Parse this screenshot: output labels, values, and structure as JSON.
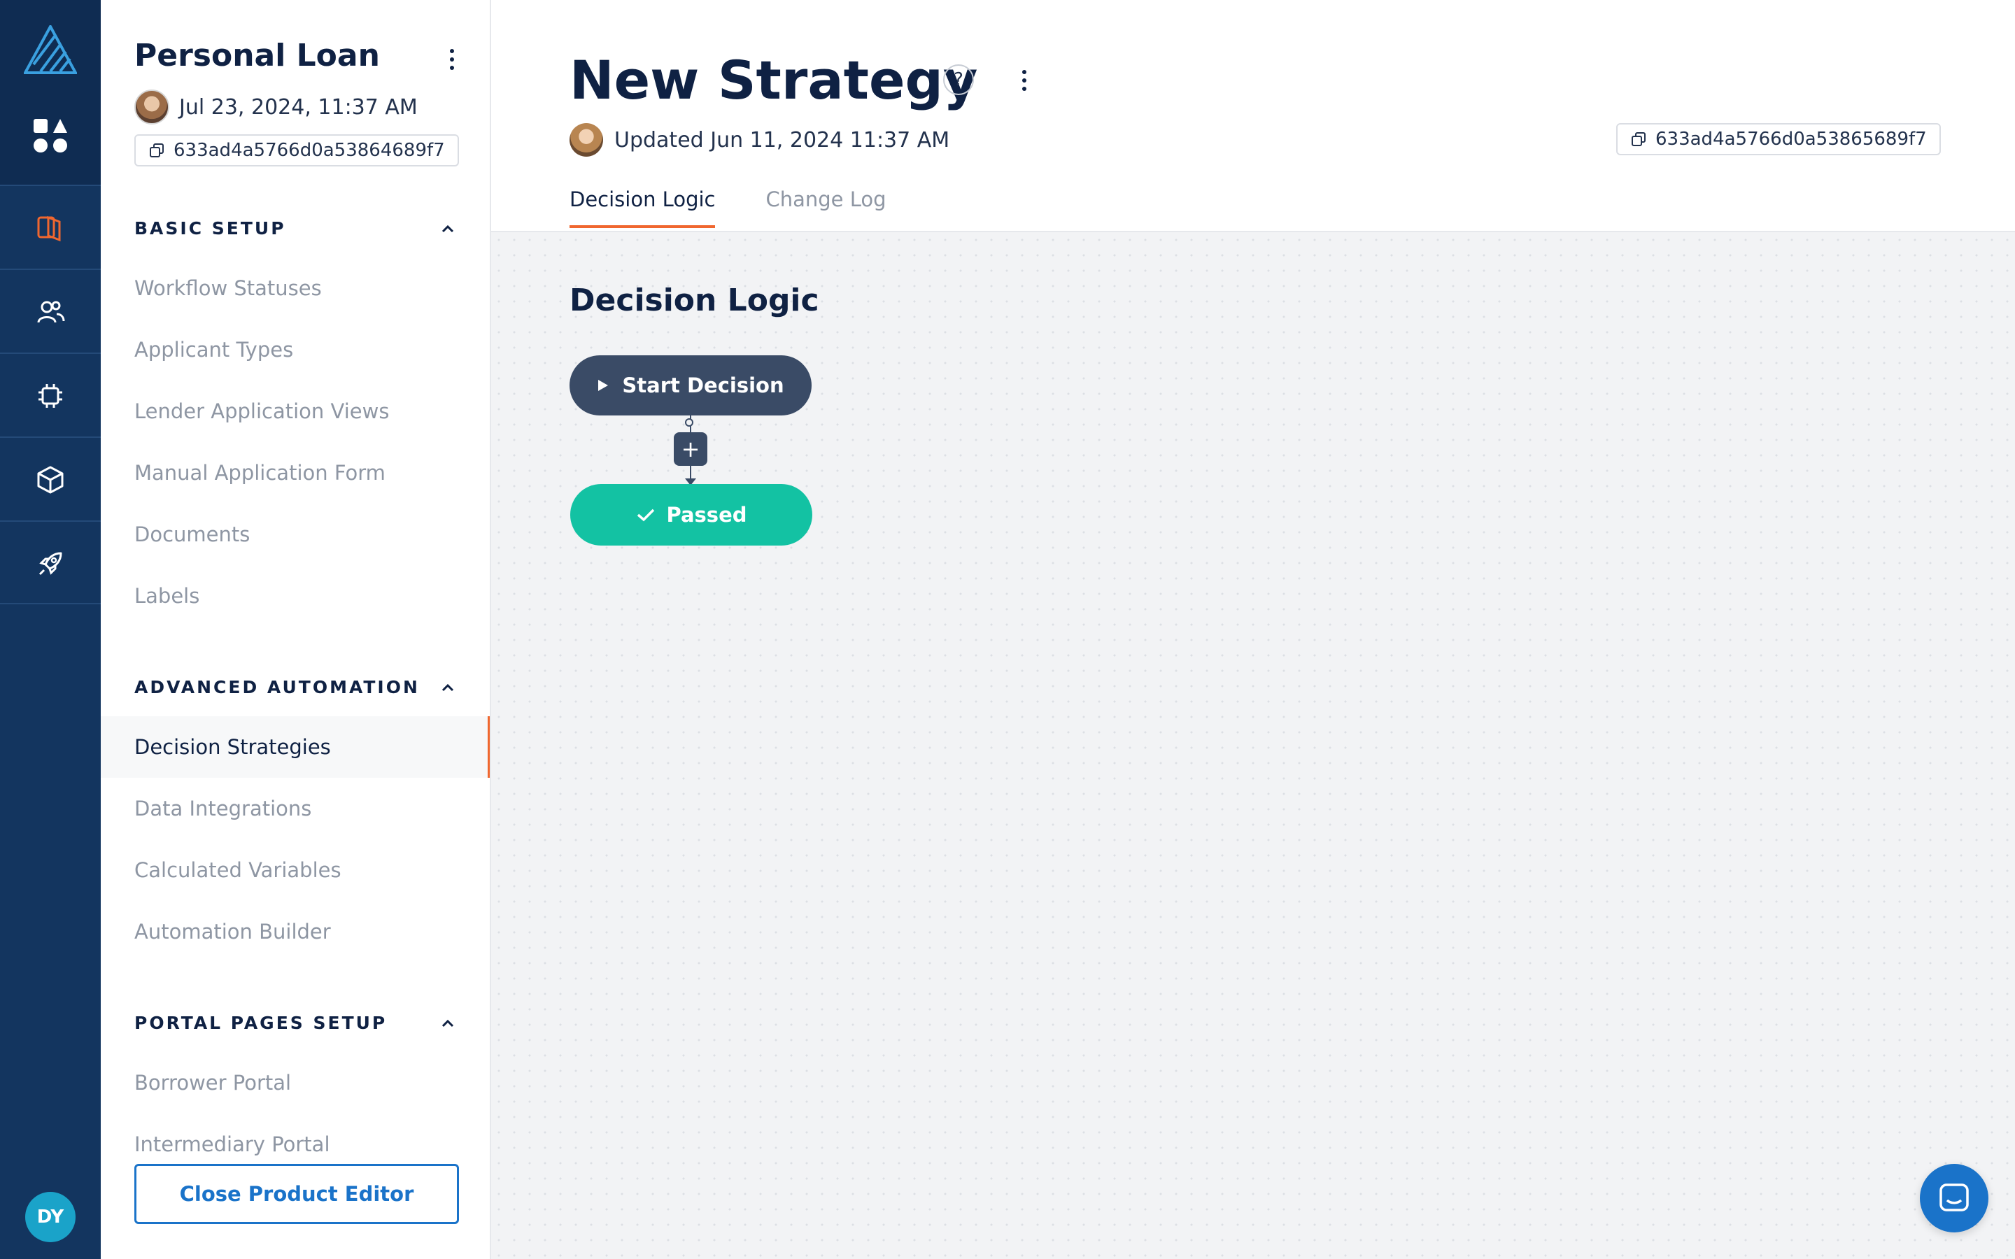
{
  "rail": {
    "icons": [
      "company-logo-icon",
      "apps-icon",
      "loan-product-icon",
      "users-icon",
      "chip-icon",
      "cube-icon",
      "rocket-icon"
    ],
    "user_initials": "DY"
  },
  "sidebar": {
    "product_title": "Personal Loan",
    "date": "Jul 23, 2024, 11:37 AM",
    "id": "633ad4a5766d0a53864689f7",
    "sections": [
      {
        "title": "BASIC SETUP",
        "items": [
          "Workflow Statuses",
          "Applicant Types",
          "Lender Application Views",
          "Manual Application Form",
          "Documents",
          "Labels"
        ]
      },
      {
        "title": "ADVANCED AUTOMATION",
        "items": [
          "Decision Strategies",
          "Data Integrations",
          "Calculated Variables",
          "Automation Builder"
        ]
      },
      {
        "title": "PORTAL PAGES SETUP",
        "items": [
          "Borrower Portal",
          "Intermediary Portal"
        ]
      }
    ],
    "active_item": "Decision Strategies",
    "close_button": "Close Product Editor"
  },
  "header": {
    "title": "New Strategy",
    "help": "?",
    "updated": "Updated Jun 11, 2024 11:37 AM",
    "id": "633ad4a5766d0a53865689f7",
    "tabs": [
      "Decision Logic",
      "Change Log"
    ],
    "active_tab": "Decision Logic"
  },
  "canvas": {
    "title": "Decision Logic",
    "start_node": "Start Decision",
    "add_symbol": "+",
    "result_node": "Passed"
  },
  "colors": {
    "rail": "#13355f",
    "accent": "#f0672f",
    "link": "#1a73c9",
    "start_node": "#3a4b66",
    "passed_node": "#13c2a3"
  }
}
